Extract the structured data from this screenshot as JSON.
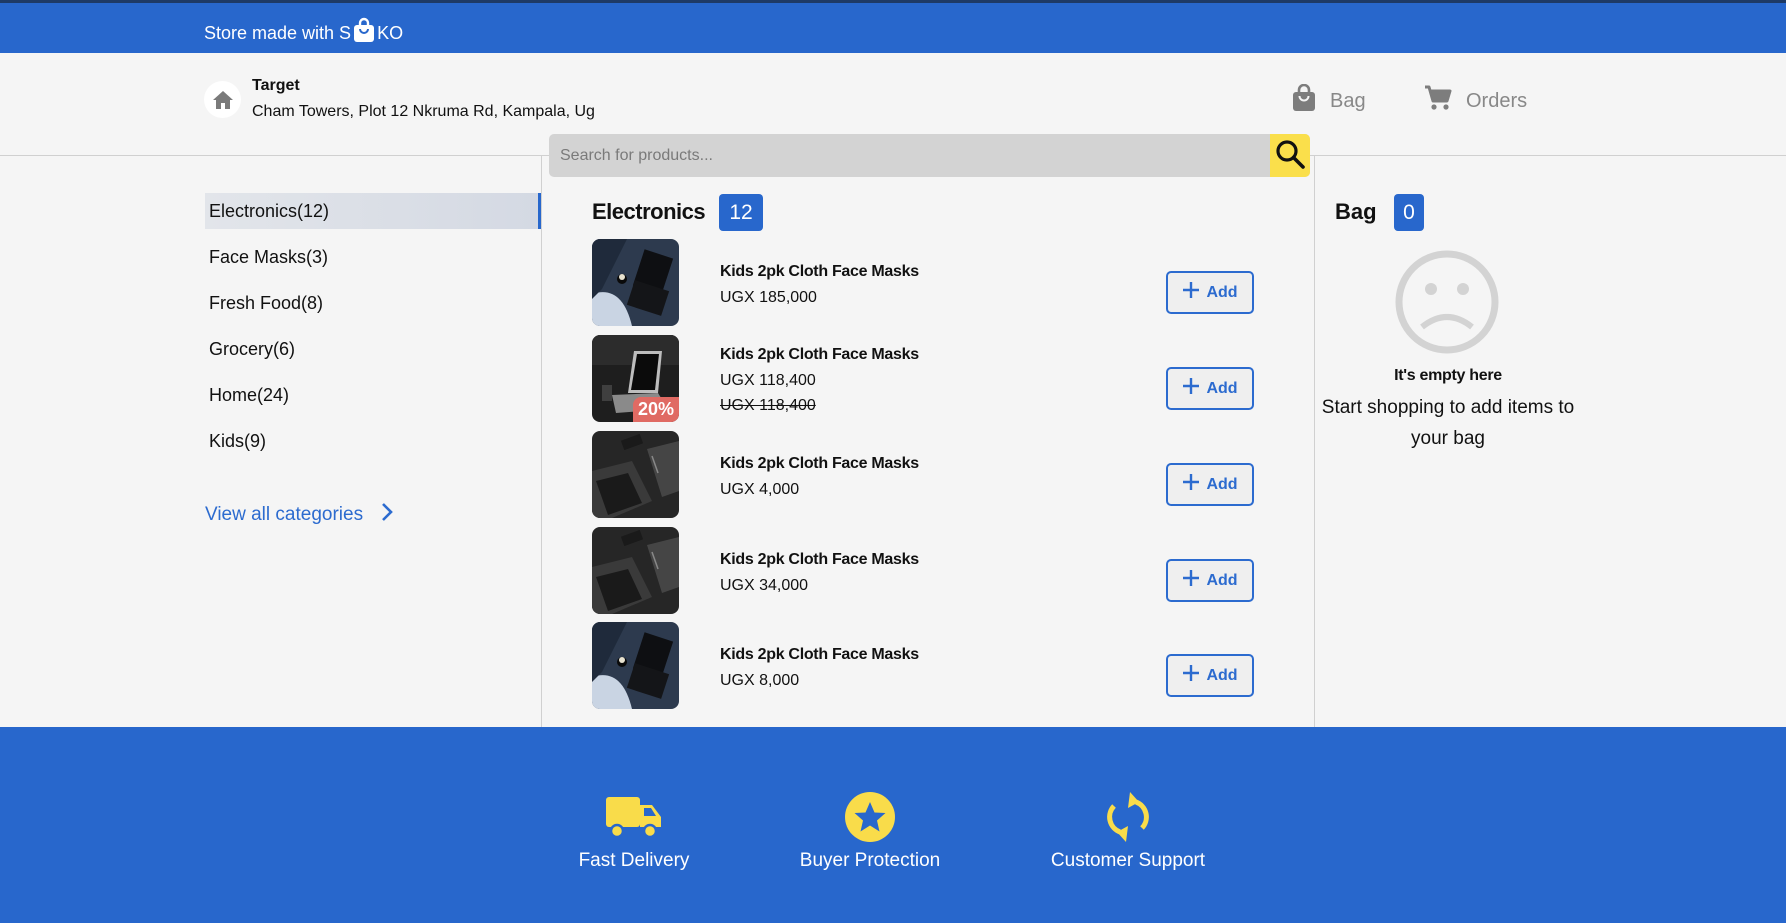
{
  "topbar": {
    "text_before": "Store made with S",
    "text_after": "KO",
    "icon": "shopping-bag-icon"
  },
  "store": {
    "name": "Target",
    "address": "Cham Towers, Plot 12 Nkruma Rd, Kampala, Ug",
    "icon": "home-icon"
  },
  "nav": {
    "bag_label": "Bag",
    "bag_icon": "shopping-bag-icon",
    "orders_label": "Orders",
    "orders_icon": "cart-icon"
  },
  "search": {
    "placeholder": "Search for products...",
    "value": "",
    "icon": "search-icon"
  },
  "sidebar": {
    "categories": [
      {
        "label": "Electronics(12)",
        "active": true
      },
      {
        "label": "Face Masks(3)",
        "active": false
      },
      {
        "label": "Fresh Food(8)",
        "active": false
      },
      {
        "label": "Grocery(6)",
        "active": false
      },
      {
        "label": "Home(24)",
        "active": false
      },
      {
        "label": "Kids(9)",
        "active": false
      }
    ],
    "view_all_label": "View all categories"
  },
  "main": {
    "title": "Electronics",
    "count": "12",
    "add_label": "Add",
    "products": [
      {
        "name": "Kids 2pk Cloth Face Masks",
        "price": "UGX 185,000",
        "old_price": null,
        "discount": null,
        "image": "laptop-bed"
      },
      {
        "name": "Kids 2pk Cloth Face Masks",
        "price": "UGX 118,400",
        "old_price": "UGX 118,400",
        "discount": "20%",
        "image": "laptop-desk"
      },
      {
        "name": "Kids 2pk Cloth Face Masks",
        "price": "UGX 4,000",
        "old_price": null,
        "discount": null,
        "image": "laptop-dark"
      },
      {
        "name": "Kids 2pk Cloth Face Masks",
        "price": "UGX 34,000",
        "old_price": null,
        "discount": null,
        "image": "laptop-dark"
      },
      {
        "name": "Kids 2pk Cloth Face Masks",
        "price": "UGX 8,000",
        "old_price": null,
        "discount": null,
        "image": "laptop-bed"
      }
    ]
  },
  "bag": {
    "title": "Bag",
    "count": "0",
    "empty_title": "It's empty here",
    "empty_message": "Start shopping to add items to your bag"
  },
  "footer": {
    "features": [
      {
        "label": "Fast Delivery",
        "icon": "truck-icon"
      },
      {
        "label": "Buyer Protection",
        "icon": "star-badge-icon"
      },
      {
        "label": "Customer Support",
        "icon": "refresh-icon"
      }
    ]
  },
  "colors": {
    "brand": "#2867cc",
    "accent": "#fadf4b",
    "discount": "#e06a63",
    "background": "#f5f5f5"
  }
}
